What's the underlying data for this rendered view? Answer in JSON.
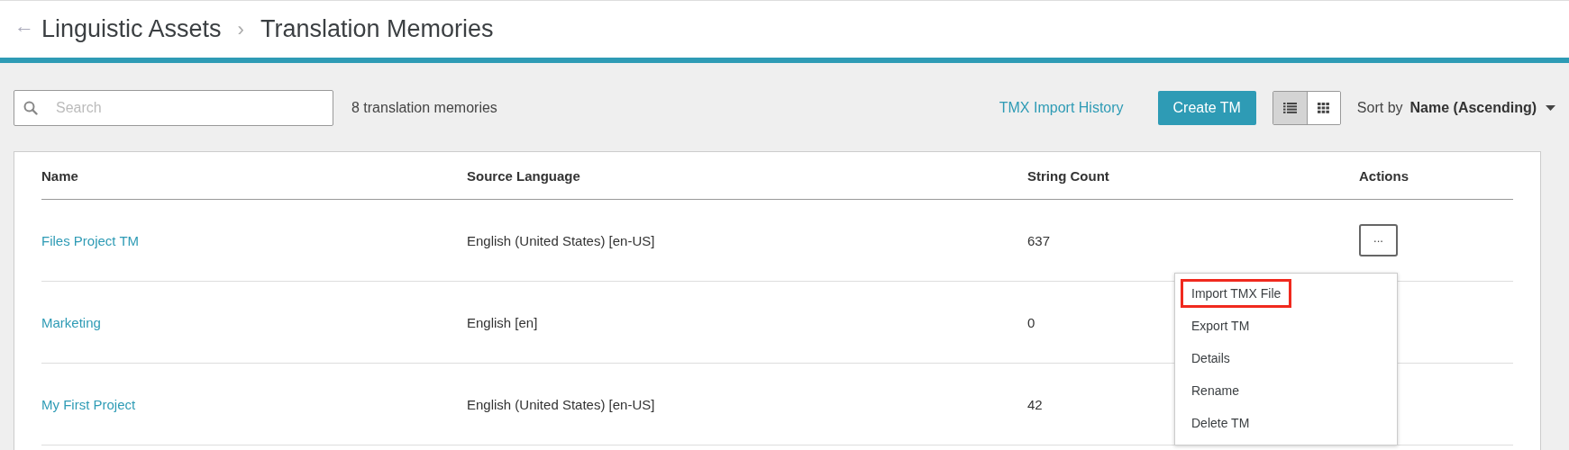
{
  "breadcrumb": {
    "back": "←",
    "items": [
      "Linguistic Assets",
      "Translation Memories"
    ],
    "separator": "›"
  },
  "toolbar": {
    "search": {
      "placeholder": "Search"
    },
    "count": "8 translation memories",
    "history_link": "TMX Import History",
    "create_button": "Create TM",
    "views": [
      {
        "kind": "list",
        "selected": true
      },
      {
        "kind": "grid",
        "selected": false
      }
    ],
    "sort": {
      "label": "Sort by",
      "value": "Name (Ascending)"
    }
  },
  "table": {
    "columns": [
      "Name",
      "Source Language",
      "String Count",
      "Actions"
    ],
    "rows": [
      {
        "name": "Files Project TM",
        "source_language": "English (United States) [en-US]",
        "string_count": "637",
        "actions": "..."
      },
      {
        "name": "Marketing",
        "source_language": "English [en]",
        "string_count": "0"
      },
      {
        "name": "My First Project",
        "source_language": "English (United States) [en-US]",
        "string_count": "42"
      }
    ]
  },
  "actions_menu": {
    "items": [
      {
        "label": "Import TMX File",
        "highlighted": true
      },
      {
        "label": "Export TM",
        "highlighted": false
      },
      {
        "label": "Details",
        "highlighted": false
      },
      {
        "label": "Rename",
        "highlighted": false
      },
      {
        "label": "Delete TM",
        "highlighted": false
      }
    ]
  }
}
